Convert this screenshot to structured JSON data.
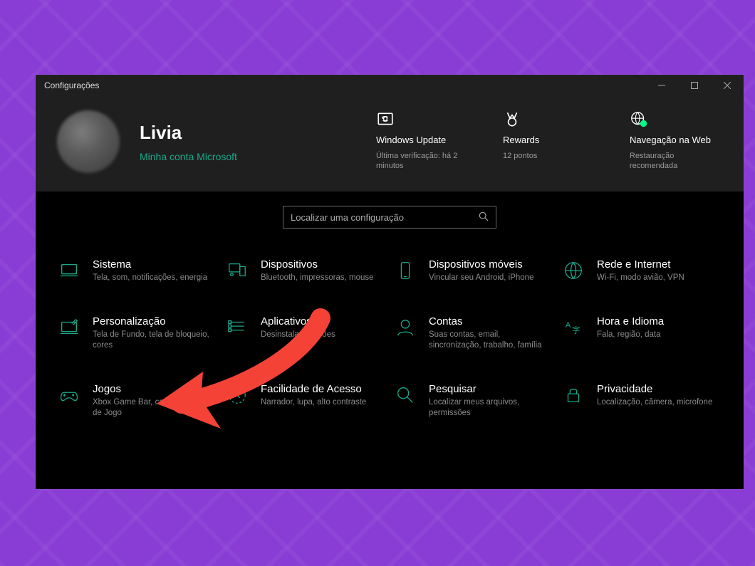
{
  "window": {
    "title": "Configurações"
  },
  "user": {
    "name": "Livia",
    "account_link": "Minha conta Microsoft"
  },
  "tiles": [
    {
      "id": "windows-update",
      "title": "Windows Update",
      "sub": "Última verificação: há 2 minutos"
    },
    {
      "id": "rewards",
      "title": "Rewards",
      "sub": "12 pontos"
    },
    {
      "id": "web-browsing",
      "title": "Navegação na Web",
      "sub": "Restauração recomendada"
    }
  ],
  "search": {
    "placeholder": "Localizar uma configuração"
  },
  "categories": [
    {
      "id": "system",
      "icon": "laptop-icon",
      "title": "Sistema",
      "sub": "Tela, som, notificações, energia"
    },
    {
      "id": "devices",
      "icon": "devices-icon",
      "title": "Dispositivos",
      "sub": "Bluetooth, impressoras, mouse"
    },
    {
      "id": "mobile",
      "icon": "phone-icon",
      "title": "Dispositivos móveis",
      "sub": "Vincular seu Android, iPhone"
    },
    {
      "id": "network",
      "icon": "globe-icon",
      "title": "Rede e Internet",
      "sub": "Wi-Fi, modo avião, VPN"
    },
    {
      "id": "personalization",
      "icon": "brush-icon",
      "title": "Personalização",
      "sub": "Tela de Fundo, tela de bloqueio, cores"
    },
    {
      "id": "apps",
      "icon": "apps-icon",
      "title": "Aplicativos",
      "sub": "Desinstalar, padrões"
    },
    {
      "id": "accounts",
      "icon": "person-icon",
      "title": "Contas",
      "sub": "Suas contas, email, sincronização, trabalho, família"
    },
    {
      "id": "time-language",
      "icon": "time-lang-icon",
      "title": "Hora e Idioma",
      "sub": "Fala, região, data"
    },
    {
      "id": "gaming",
      "icon": "gamepad-icon",
      "title": "Jogos",
      "sub": "Xbox Game Bar, capturas, Modo de Jogo"
    },
    {
      "id": "ease-of-access",
      "icon": "ease-icon",
      "title": "Facilidade de Acesso",
      "sub": "Narrador, lupa, alto contraste"
    },
    {
      "id": "search",
      "icon": "search-icon",
      "title": "Pesquisar",
      "sub": "Localizar meus arquivos, permissões"
    },
    {
      "id": "privacy",
      "icon": "lock-icon",
      "title": "Privacidade",
      "sub": "Localização, câmera, microfone"
    }
  ],
  "annotation": {
    "target": "personalization",
    "color": "#f44336"
  }
}
